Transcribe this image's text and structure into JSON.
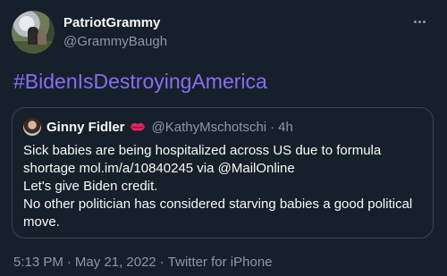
{
  "author": {
    "display_name": "PatriotGrammy",
    "handle": "@GrammyBaugh"
  },
  "tweet": {
    "text": "#BidenIsDestroyingAmerica",
    "time": "5:13 PM",
    "separator": "·",
    "date": "May 21, 2022",
    "source": "Twitter for iPhone"
  },
  "quoted": {
    "display_name": "Ginny Fidler",
    "emoji_icon": "lips-kiss-icon",
    "handle": "@KathyMschotschi",
    "separator": "·",
    "time": "4h",
    "lines": [
      "Sick babies are being hospitalized across US due to formula",
      "shortage mol.im/a/10840245 via @MailOnline",
      "Let's give Biden credit.",
      "No other politician has considered starving babies a good political",
      "move."
    ]
  },
  "colors": {
    "background": "#15202b",
    "text": "#f7f9f9",
    "muted": "#8b98a5",
    "hashtag": "#8b6cf2",
    "border": "#38444d"
  }
}
